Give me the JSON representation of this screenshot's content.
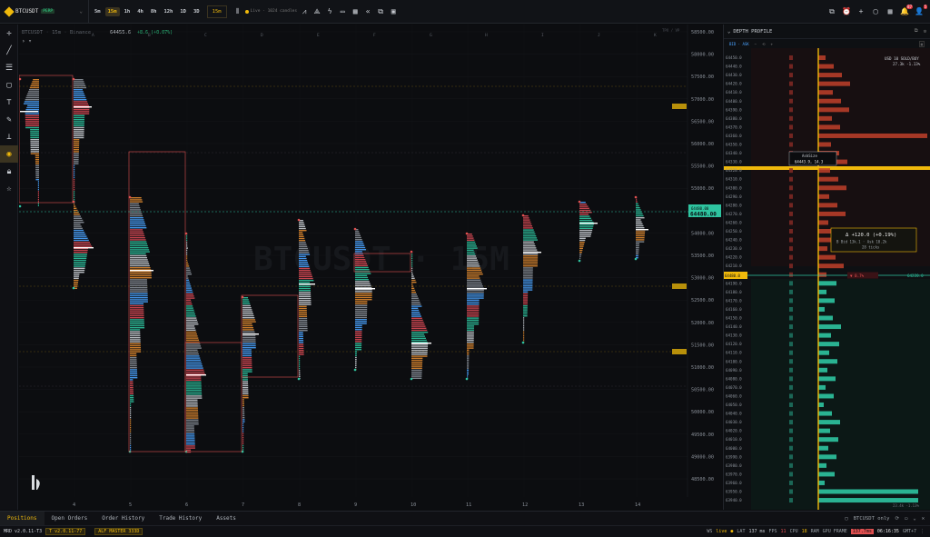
{
  "toolbar": {
    "symbol": "BTCUSDT",
    "symbol_badge": "PERP",
    "timeframes": [
      "5m",
      "15m",
      "1h",
      "4h",
      "8h",
      "12h",
      "1D",
      "3D"
    ],
    "active_timeframe": "15m",
    "interval_selector": "15m",
    "live_label": "Live · 1024 candles",
    "notifications_count": "87",
    "alerts_count": "5"
  },
  "chart": {
    "legend_symbol": "BTCUSDT · 15m · Binance",
    "legend_price": "64455.6",
    "legend_change": "+8.6 (+0.07%)",
    "watermark": "BTCUSDT · 15M",
    "top_right_note": "TPO / VP",
    "price_axis": [
      "58500.00",
      "58000.00",
      "57500.00",
      "57000.00",
      "56500.00",
      "56000.00",
      "55500.00",
      "55000.00",
      "54500.00",
      "54000.00",
      "53500.00",
      "53000.00",
      "52500.00",
      "52000.00",
      "51500.00",
      "51000.00",
      "50500.00",
      "50000.00",
      "49500.00",
      "49000.00",
      "48500.00"
    ],
    "current_price": "64480.00",
    "current_price_sub": "64480.00",
    "x_labels": [
      "4",
      "5",
      "6",
      "7",
      "8",
      "9",
      "10",
      "11",
      "12",
      "13",
      "14"
    ],
    "session_letters": [
      "A",
      "B",
      "C",
      "D",
      "E",
      "F",
      "G",
      "H",
      "I",
      "J",
      "K"
    ]
  },
  "depth": {
    "title": "DEPTH PROFILE",
    "sub_label": "BID · ASK",
    "summary": "USD 10 SOLD/BUY",
    "summary_value": "27.3k  -1.13%",
    "prices": [
      "64450.0",
      "64440.0",
      "64430.0",
      "64420.0",
      "64410.0",
      "64400.0",
      "64390.0",
      "64380.0",
      "64370.0",
      "64360.0",
      "64350.0",
      "64340.0",
      "64330.0",
      "64320.0",
      "64310.0",
      "64300.0",
      "64290.0",
      "64280.0",
      "64270.0",
      "64260.0",
      "64250.0",
      "64240.0",
      "64230.0",
      "64220.0",
      "64210.0",
      "64200.0",
      "64190.0",
      "64180.0",
      "64170.0",
      "64160.0",
      "64150.0",
      "64140.0",
      "64130.0",
      "64120.0",
      "64110.0",
      "64100.0",
      "64090.0",
      "64080.0",
      "64070.0",
      "64060.0",
      "64050.0",
      "64040.0",
      "64030.0",
      "64020.0",
      "64010.0",
      "64000.0",
      "63990.0",
      "63980.0",
      "63970.0",
      "63960.0",
      "63950.0",
      "63940.0"
    ],
    "tooltip_title": "AskSize",
    "tooltip_value": "64443.9, 14.3",
    "delta_title": "Δ +120.0 (+0.19%)",
    "delta_line2": "B Bid 13k.1  ·  Ask 10.2k",
    "delta_line3": "28 ticks",
    "marker_price": "64480.0",
    "marker_change": "▼ 0.7%",
    "marker_right": "64220.0",
    "bottom_value": "23.4k  -1.13%"
  },
  "bottom": {
    "tabs": [
      "Positions",
      "Open Orders",
      "Order History",
      "Trade History",
      "Assets"
    ],
    "filter_label": "BTCUSDT only",
    "app_version": "MRD v2.0.11-T3",
    "version_badge": "T v2.0.11-77",
    "mode_badge": "ALF MASTER 333D",
    "ws_label": "WS",
    "ws_status": "live",
    "lat_label": "LAT",
    "lat_value": "137 ms",
    "fps_label": "FPS",
    "fps_value": "11",
    "cpu_label": "CPU",
    "cpu_value": "18",
    "ram_label": "RAM",
    "gpu_label": "GPU FRAME",
    "gpu_value": "137.7ms",
    "clock": "06:16:35",
    "tz": "GMT+7"
  },
  "colors": {
    "accent": "#f0b90b",
    "bid": "#2ec4a0",
    "ask": "#e05050",
    "buy": "#4aa3ff",
    "sell": "#d94a55",
    "poc": "#f0b90b"
  }
}
